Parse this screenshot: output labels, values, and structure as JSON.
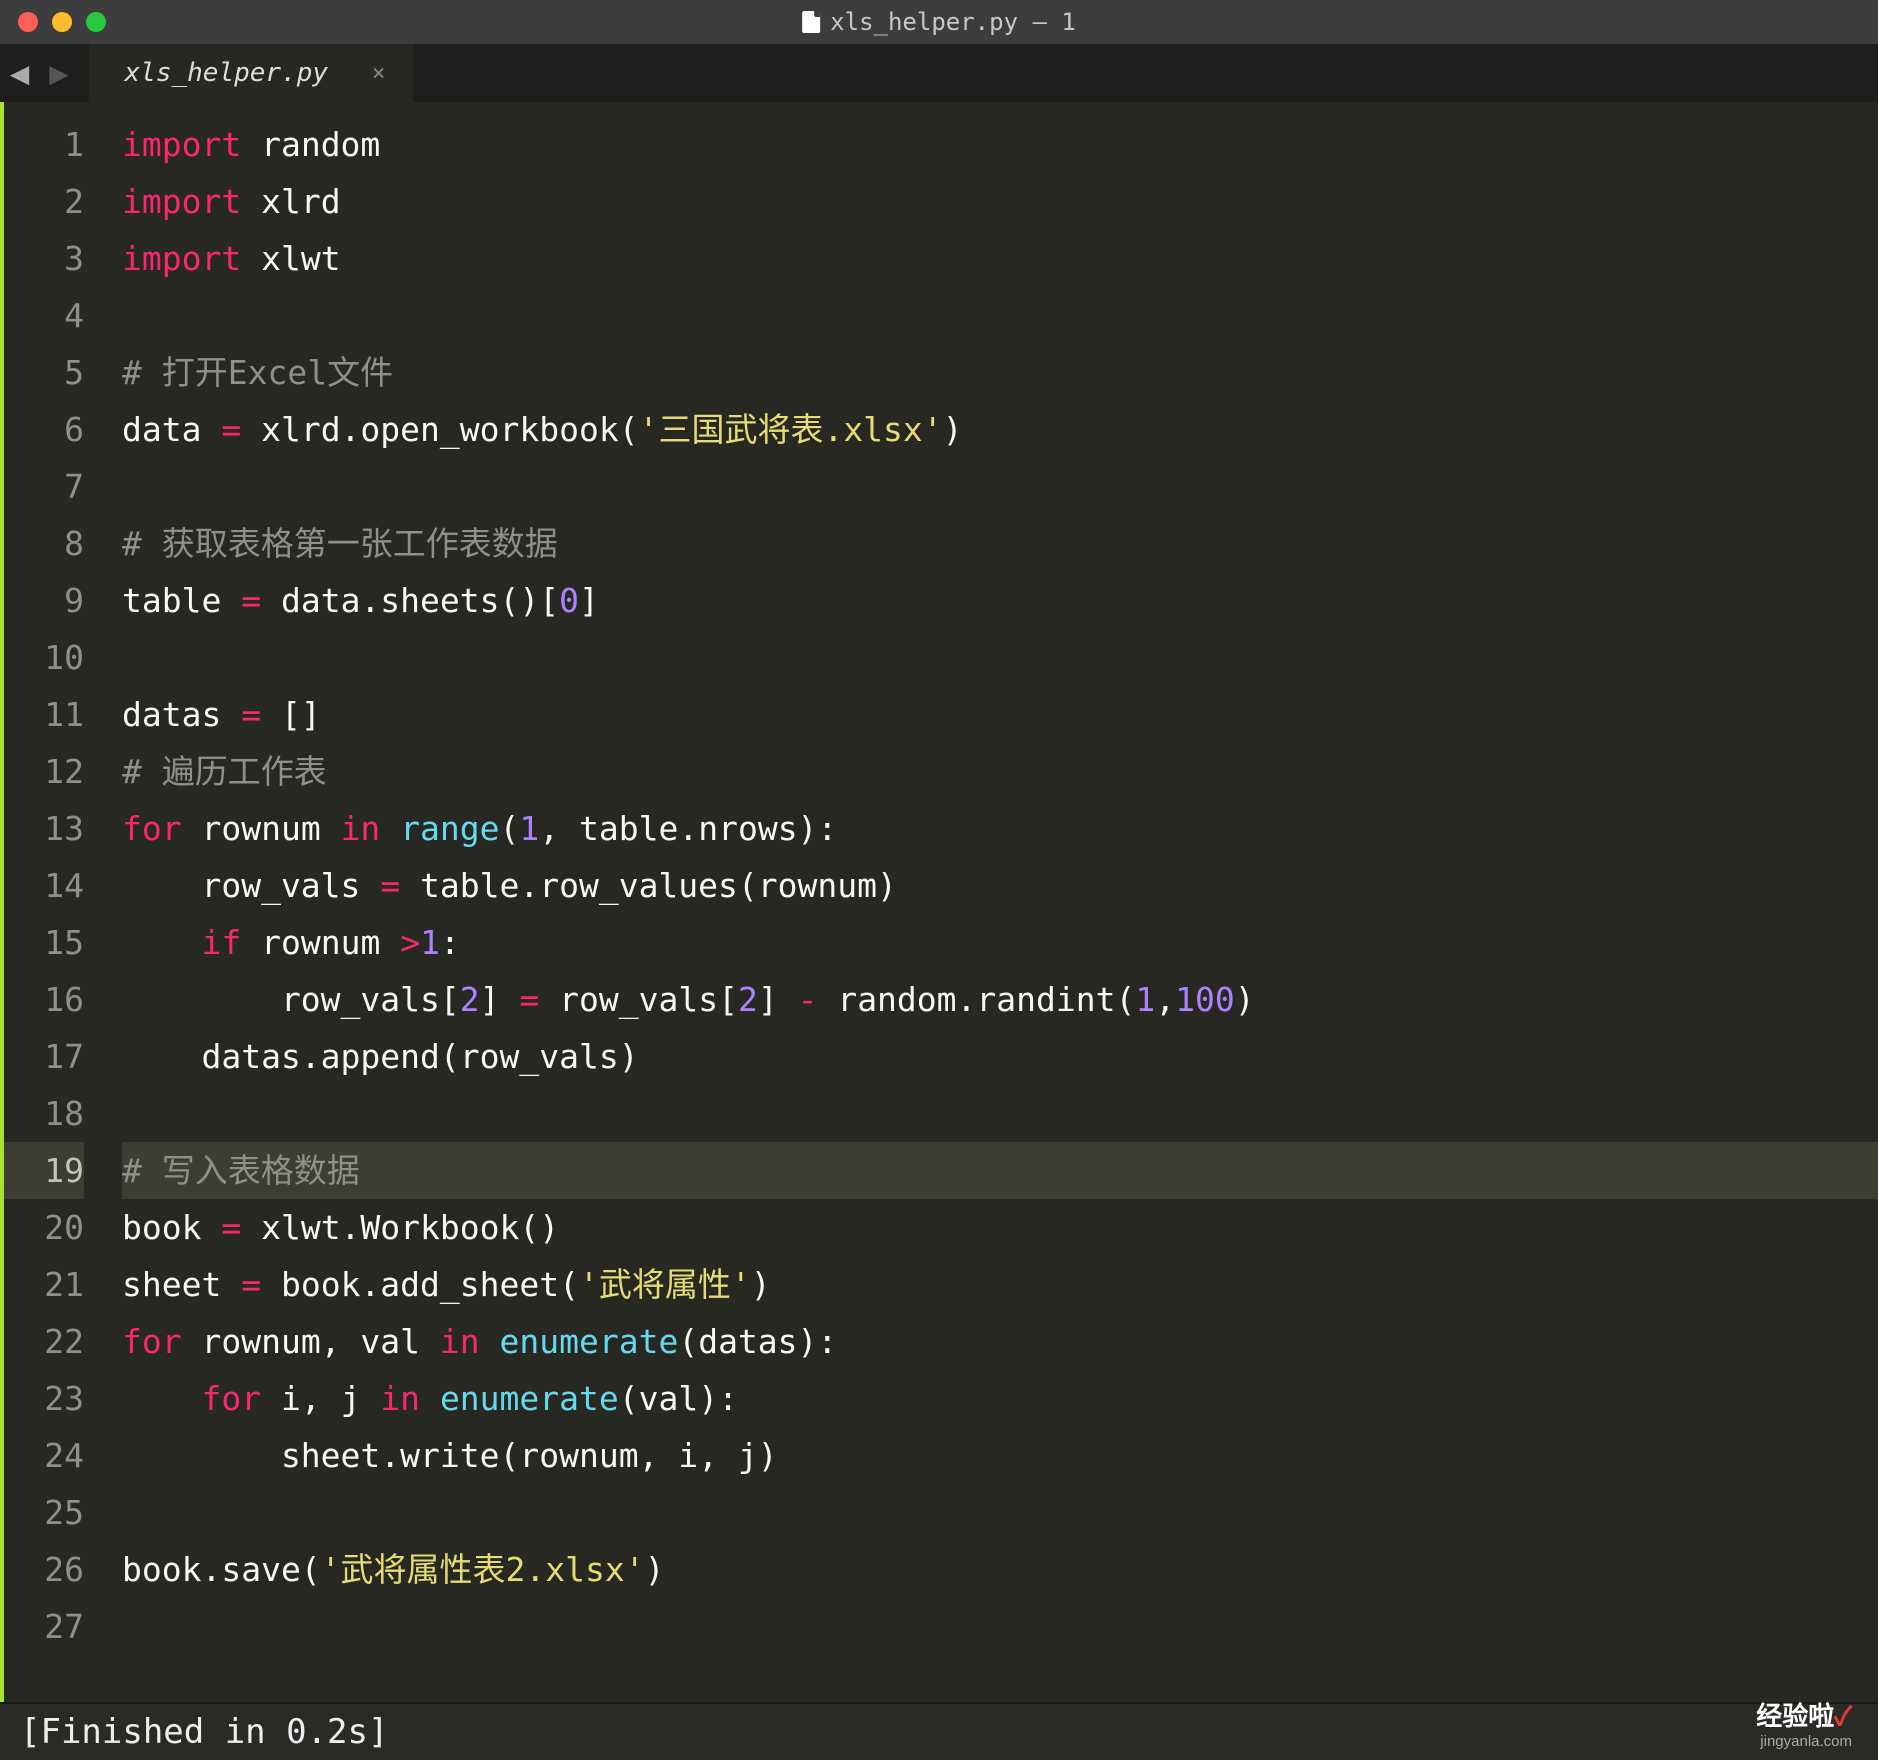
{
  "titlebar": {
    "title": "xls_helper.py — 1"
  },
  "tab": {
    "name": "xls_helper.py",
    "close": "×"
  },
  "nav": {
    "back": "◀",
    "forward": "▶"
  },
  "lines": [
    {
      "n": "1",
      "t": [
        [
          "kw",
          "import"
        ],
        [
          "plain",
          " random"
        ]
      ]
    },
    {
      "n": "2",
      "t": [
        [
          "kw",
          "import"
        ],
        [
          "plain",
          " xlrd"
        ]
      ]
    },
    {
      "n": "3",
      "t": [
        [
          "kw",
          "import"
        ],
        [
          "plain",
          " xlwt"
        ]
      ]
    },
    {
      "n": "4",
      "t": []
    },
    {
      "n": "5",
      "t": [
        [
          "com",
          "# 打开Excel文件"
        ]
      ]
    },
    {
      "n": "6",
      "t": [
        [
          "plain",
          "data "
        ],
        [
          "op",
          "="
        ],
        [
          "plain",
          " xlrd.open_workbook("
        ],
        [
          "str",
          "'三国武将表.xlsx'"
        ],
        [
          "plain",
          ")"
        ]
      ]
    },
    {
      "n": "7",
      "t": []
    },
    {
      "n": "8",
      "t": [
        [
          "com",
          "# 获取表格第一张工作表数据"
        ]
      ]
    },
    {
      "n": "9",
      "t": [
        [
          "plain",
          "table "
        ],
        [
          "op",
          "="
        ],
        [
          "plain",
          " data.sheets()["
        ],
        [
          "num",
          "0"
        ],
        [
          "plain",
          "]"
        ]
      ]
    },
    {
      "n": "10",
      "t": []
    },
    {
      "n": "11",
      "t": [
        [
          "plain",
          "datas "
        ],
        [
          "op",
          "="
        ],
        [
          "plain",
          " []"
        ]
      ]
    },
    {
      "n": "12",
      "t": [
        [
          "com",
          "# 遍历工作表"
        ]
      ]
    },
    {
      "n": "13",
      "t": [
        [
          "kw",
          "for"
        ],
        [
          "plain",
          " rownum "
        ],
        [
          "kw",
          "in"
        ],
        [
          "plain",
          " "
        ],
        [
          "fn",
          "range"
        ],
        [
          "plain",
          "("
        ],
        [
          "num",
          "1"
        ],
        [
          "plain",
          ", table.nrows):"
        ]
      ]
    },
    {
      "n": "14",
      "t": [
        [
          "plain",
          "    row_vals "
        ],
        [
          "op",
          "="
        ],
        [
          "plain",
          " table.row_values(rownum)"
        ]
      ]
    },
    {
      "n": "15",
      "t": [
        [
          "plain",
          "    "
        ],
        [
          "kw",
          "if"
        ],
        [
          "plain",
          " rownum "
        ],
        [
          "op",
          ">"
        ],
        [
          "num",
          "1"
        ],
        [
          "plain",
          ":"
        ]
      ]
    },
    {
      "n": "16",
      "t": [
        [
          "plain",
          "        row_vals["
        ],
        [
          "num",
          "2"
        ],
        [
          "plain",
          "] "
        ],
        [
          "op",
          "="
        ],
        [
          "plain",
          " row_vals["
        ],
        [
          "num",
          "2"
        ],
        [
          "plain",
          "] "
        ],
        [
          "op",
          "-"
        ],
        [
          "plain",
          " random.randint("
        ],
        [
          "num",
          "1"
        ],
        [
          "plain",
          ","
        ],
        [
          "num",
          "100"
        ],
        [
          "plain",
          ")"
        ]
      ]
    },
    {
      "n": "17",
      "t": [
        [
          "plain",
          "    datas.append(row_vals)"
        ]
      ]
    },
    {
      "n": "18",
      "t": []
    },
    {
      "n": "19",
      "t": [
        [
          "com",
          "# 写入表格数据"
        ]
      ],
      "hl": true
    },
    {
      "n": "20",
      "t": [
        [
          "plain",
          "book "
        ],
        [
          "op",
          "="
        ],
        [
          "plain",
          " xlwt.Workbook()"
        ]
      ]
    },
    {
      "n": "21",
      "t": [
        [
          "plain",
          "sheet "
        ],
        [
          "op",
          "="
        ],
        [
          "plain",
          " book.add_sheet("
        ],
        [
          "str",
          "'武将属性'"
        ],
        [
          "plain",
          ")"
        ]
      ]
    },
    {
      "n": "22",
      "t": [
        [
          "kw",
          "for"
        ],
        [
          "plain",
          " rownum, val "
        ],
        [
          "kw",
          "in"
        ],
        [
          "plain",
          " "
        ],
        [
          "fn",
          "enumerate"
        ],
        [
          "plain",
          "(datas):"
        ]
      ]
    },
    {
      "n": "23",
      "t": [
        [
          "plain",
          "    "
        ],
        [
          "kw",
          "for"
        ],
        [
          "plain",
          " i, j "
        ],
        [
          "kw",
          "in"
        ],
        [
          "plain",
          " "
        ],
        [
          "fn",
          "enumerate"
        ],
        [
          "plain",
          "(val):"
        ]
      ]
    },
    {
      "n": "24",
      "t": [
        [
          "plain",
          "        sheet.write(rownum, i, j)"
        ]
      ]
    },
    {
      "n": "25",
      "t": []
    },
    {
      "n": "26",
      "t": [
        [
          "plain",
          "book.save("
        ],
        [
          "str",
          "'武将属性表2.xlsx'"
        ],
        [
          "plain",
          ")"
        ]
      ]
    },
    {
      "n": "27",
      "t": []
    }
  ],
  "status": {
    "text": "[Finished in 0.2s]"
  },
  "watermark": {
    "top_cn": "经验啦",
    "top_check": "✓",
    "sub": "jingyanla.com"
  }
}
